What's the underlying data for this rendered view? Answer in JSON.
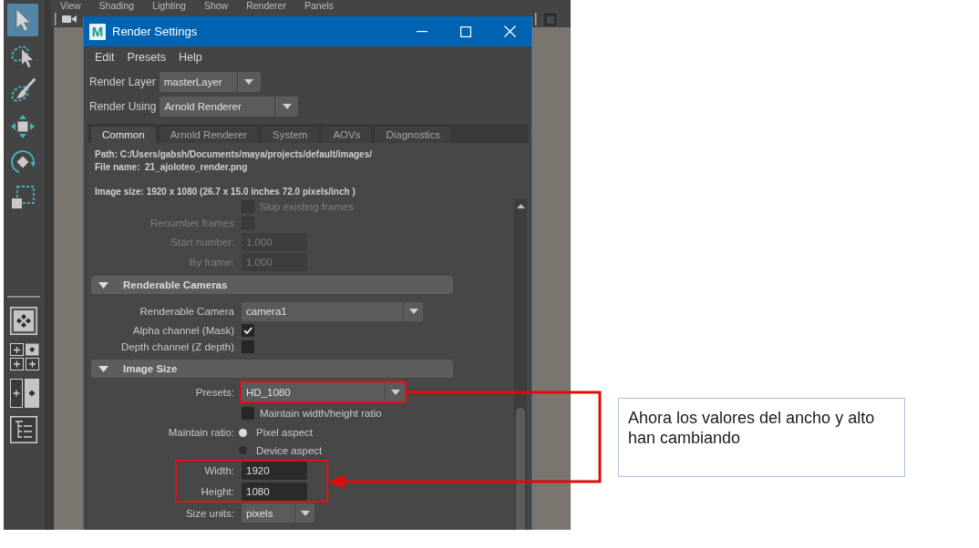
{
  "viewport": {
    "menu": [
      "View",
      "Shading",
      "Lighting",
      "Show",
      "Renderer",
      "Panels"
    ]
  },
  "toolbox": {
    "tools": [
      {
        "kind": "select",
        "selected": true
      },
      {
        "kind": "lasso",
        "selected": false
      },
      {
        "kind": "paint_select",
        "selected": false
      },
      {
        "kind": "move",
        "selected": false
      },
      {
        "kind": "rotate",
        "selected": false
      },
      {
        "kind": "scale",
        "selected": false
      }
    ]
  },
  "render_settings": {
    "logo": "M",
    "title": "Render Settings",
    "menu": [
      "Edit",
      "Presets",
      "Help"
    ],
    "render_layer": {
      "label": "Render Layer",
      "value": "masterLayer"
    },
    "render_using": {
      "label": "Render Using",
      "value": "Arnold Renderer"
    },
    "tabs": [
      {
        "label": "Common",
        "selected": true
      },
      {
        "label": "Arnold Renderer",
        "selected": false
      },
      {
        "label": "System",
        "selected": false
      },
      {
        "label": "AOVs",
        "selected": false
      },
      {
        "label": "Diagnostics",
        "selected": false
      }
    ],
    "info": {
      "path": "Path: C:/Users/gabsh/Documents/maya/projects/default/images/",
      "file_name": "File name:  21_ajoloteo_render.png",
      "image_size": "Image size: 1920 x 1080 (26.7 x 15.0 inches 72.0 pixels/inch )"
    },
    "rows": [
      {
        "kind": "checkbox",
        "text": "Skip existing frames",
        "checked": false,
        "disabled": true,
        "highlighted": false
      },
      {
        "kind": "checkbox",
        "label": "Renumber frames",
        "checked": false,
        "disabled": true,
        "highlighted": false
      },
      {
        "kind": "field",
        "label": "Start number:",
        "value": "1.000",
        "disabled": true,
        "highlighted": false
      },
      {
        "kind": "field",
        "label": "By frame:",
        "value": "1.000",
        "disabled": true,
        "highlighted": false
      },
      {
        "kind": "section",
        "title": "Renderable Cameras",
        "expanded": true,
        "highlighted": false
      },
      {
        "kind": "dropdown",
        "label": "Renderable Camera",
        "value": "camera1",
        "highlighted": false
      },
      {
        "kind": "checkbox",
        "label": "Alpha channel (Mask)",
        "checked": true,
        "disabled": false,
        "highlighted": false
      },
      {
        "kind": "checkbox",
        "label": "Depth channel (Z depth)",
        "checked": false,
        "disabled": false,
        "highlighted": false
      },
      {
        "kind": "section",
        "title": "Image Size",
        "expanded": true,
        "highlighted": false
      },
      {
        "kind": "dropdown",
        "label": "Presets:",
        "value": "HD_1080",
        "highlighted": true
      },
      {
        "kind": "checkbox",
        "text": "Maintain width/height ratio",
        "checked": false,
        "disabled": false,
        "highlighted": false
      },
      {
        "kind": "radio",
        "label": "Maintain ratio:",
        "text": "Pixel aspect",
        "selected": true,
        "highlighted": false
      },
      {
        "kind": "radio",
        "text": "Device aspect",
        "selected": false,
        "highlighted": false
      },
      {
        "kind": "field_group",
        "fields": [
          {
            "label": "Width:",
            "value": "1920",
            "disabled": false
          },
          {
            "label": "Height:",
            "value": "1080",
            "disabled": false
          }
        ],
        "highlighted": true
      },
      {
        "kind": "dropdown",
        "label": "Size units:",
        "value": "pixels",
        "highlighted": false
      }
    ]
  },
  "annotation": {
    "callout": "Ahora los valores del ancho y alto han cambiando"
  }
}
